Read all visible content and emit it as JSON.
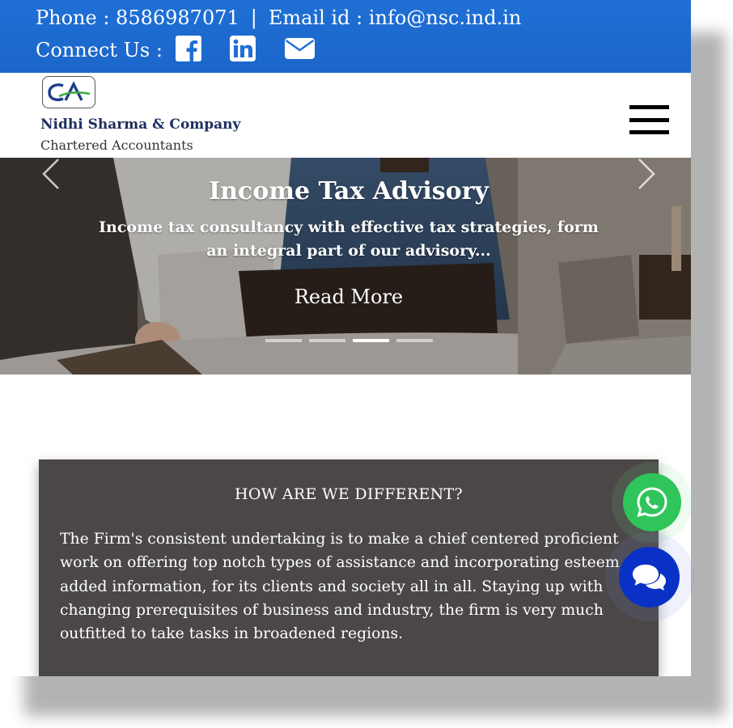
{
  "topbar": {
    "phone": "Phone : 8586987071",
    "separator": "|",
    "email": "Email id : info@nsc.ind.in",
    "connect_label": "Connect Us :",
    "social_icons": [
      "facebook-icon",
      "linkedin-icon",
      "envelope-icon"
    ]
  },
  "header": {
    "company_name": "Nidhi Sharma & Company",
    "company_subtitle": "Chartered Accountants",
    "logo_text": "CA"
  },
  "hero": {
    "title": "Income Tax Advisory",
    "description": "Income tax consultancy with effective tax strategies, form an integral part of our advisory...",
    "button_label": "Read More",
    "slide_count": 4,
    "active_slide": 3
  },
  "different": {
    "heading": "HOW ARE WE DIFFERENT?",
    "body": "The Firm's consistent undertaking is to make a chief centered proficient work on offering top notch types of assistance and incorporating esteem added information, for its clients and society all in all. Staying up with changing prerequisites of business and industry, the firm is very much outfitted to take tasks in broadened regions."
  },
  "floating": {
    "whatsapp_icon": "whatsapp-icon",
    "chat_icon": "chat-bubbles-icon"
  },
  "colors": {
    "topbar": "#1f6fd6",
    "company_name": "#1f2f60",
    "section_bg": "#4a4746",
    "whatsapp": "#2fc55b",
    "chat": "#0a31c6"
  }
}
